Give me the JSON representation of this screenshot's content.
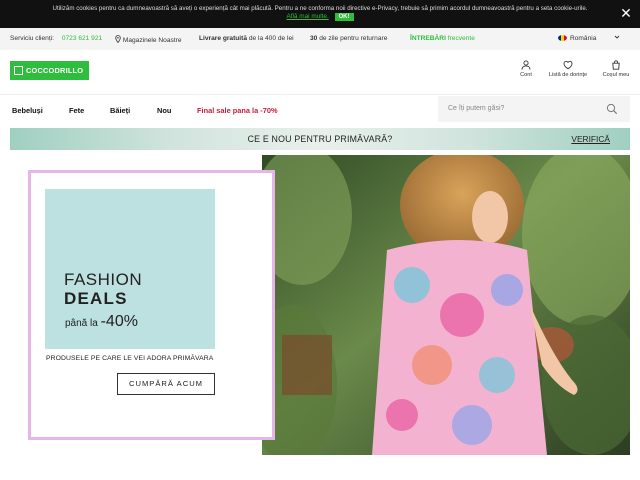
{
  "cookie": {
    "text": "Utilizăm cookies pentru ca dumneavoastră să aveți o experiență cât mai plăcută. Pentru a ne conforma noii directive e-Privacy, trebuie să primim acordul dumneavoastră pentru a seta cookie-urile.",
    "more_link": "Află mai multe.",
    "ok_label": "OK!",
    "close_icon": "close-icon"
  },
  "infobar": {
    "service_label": "Serviciu clienți:",
    "phone": "0723 621 921",
    "stores_label": "Magazinele Noastre",
    "delivery_bold": "Livrare gratuită",
    "delivery_rest": "de la 400 de lei",
    "returns_bold": "30",
    "returns_rest": "de zile pentru returnare",
    "faq_bold": "ÎNTREBĂRI",
    "faq_rest": "frecvente",
    "country": "România"
  },
  "header": {
    "logo_text": "COCCODRILLO",
    "account_label": "Cont",
    "wishlist_label": "Listă de dorințe",
    "cart_label": "Coșul meu"
  },
  "nav": {
    "items": [
      "Bebeluși",
      "Fete",
      "Băieți",
      "Nou"
    ],
    "sale_label": "Final sale pana la -70%",
    "search_placeholder": "Ce îți putem găsi?"
  },
  "strip": {
    "text": "CE E NOU PENTRU PRIMĂVARĂ?",
    "cta": "VERIFICĂ"
  },
  "hero": {
    "line1": "FASHION",
    "line2": "DEALS",
    "line3_prefix": "până la",
    "line3_value": "-40%",
    "tagline": "PRODUSELE PE CARE LE VEI ADORA PRIMĂVARA",
    "button": "CUMPĂRĂ ACUM"
  },
  "colors": {
    "brand_green": "#2ebd3c",
    "sale_red": "#c41d3b",
    "promo_bg": "#bde0e0",
    "frame_pink": "#e6b6e8"
  }
}
